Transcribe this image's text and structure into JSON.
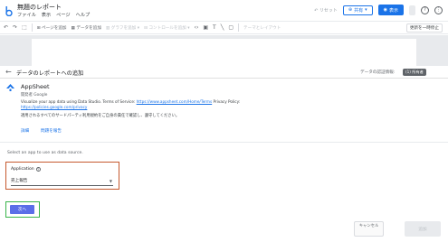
{
  "app": {
    "title": "無題のレポート",
    "menu": [
      "ファイル",
      "表示",
      "ページ",
      "ヘルプ"
    ],
    "reset_label": "リセット",
    "share_label": "共有",
    "view_label": "表示"
  },
  "toolbar": {
    "add_page": "ページを追加",
    "add_data": "データを追加",
    "add_chart": "グラフを追加",
    "add_control": "コントロールを追加",
    "theme_layout": "テーマとレイアウト",
    "reset_label": "更新を一時停止"
  },
  "panel": {
    "title": "データのレポートへの追加",
    "credentials_label": "データの認証情報:",
    "credentials_value": "(1) 所有者"
  },
  "connector": {
    "name": "AppSheet",
    "by": "開発者 Google",
    "desc_prefix": "Visualize your app data using Data Studio. Terms of Service: ",
    "terms_url": "https://www.appsheet.com/Home/Terms",
    "privacy_label": " Privacy Policy:",
    "privacy_url": "https://policies.google.com/privacy",
    "notice": "適用されるすべてのサードパーティ利用規約をご自身の責任で確認し、遵守してください。",
    "details_link": "詳細",
    "report_link": "問題を報告"
  },
  "selection": {
    "prompt": "Select an app to use as data source.",
    "application_label": "Application",
    "application_value": "売上報告"
  },
  "buttons": {
    "next": "次へ",
    "cancel": "キャンセル",
    "add": "追加"
  },
  "colors": {
    "primary": "#1a73e8",
    "app_box_border": "#c5592e",
    "next_box_border": "#3ab54a",
    "next_button": "#5b6ee8"
  }
}
